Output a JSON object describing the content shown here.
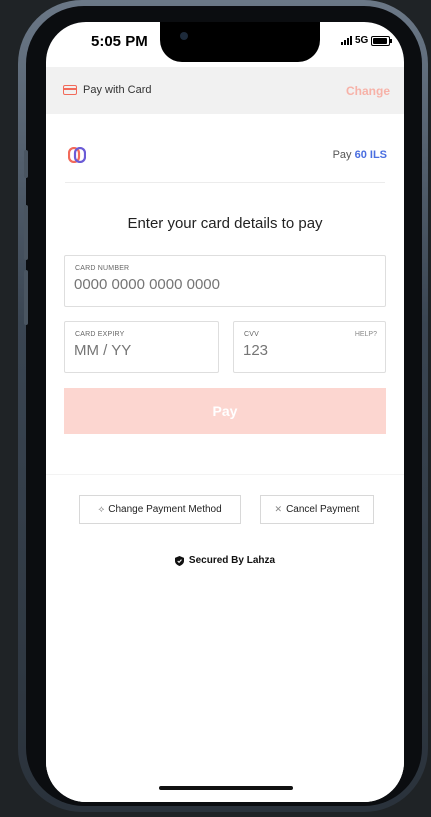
{
  "status_bar": {
    "time": "5:05 PM",
    "network": "5G"
  },
  "pay_header": {
    "title": "Pay with Card",
    "change_label": "Change"
  },
  "merchant": {
    "pay_prefix": "Pay",
    "amount": "60 ILS",
    "logo_icon": "brand-logo-icon"
  },
  "form": {
    "heading": "Enter your card details to pay",
    "card_number": {
      "label": "CARD NUMBER",
      "placeholder": "0000 0000 0000 0000"
    },
    "card_expiry": {
      "label": "CARD EXPIRY",
      "placeholder": "MM / YY"
    },
    "cvv": {
      "label": "CVV",
      "help": "HELP?",
      "placeholder": "123"
    },
    "pay_label": "Pay"
  },
  "actions": {
    "change_method": {
      "label": "Change Payment Method",
      "icon": "swap-icon"
    },
    "cancel": {
      "label": "Cancel Payment",
      "icon": "close-icon"
    }
  },
  "footer": {
    "secured_text": "Secured By Lahza",
    "icon": "shield-icon"
  },
  "colors": {
    "accent": "#f26a5a",
    "accent_light": "#fcd6d0",
    "amount_blue": "#4a6ee0"
  }
}
